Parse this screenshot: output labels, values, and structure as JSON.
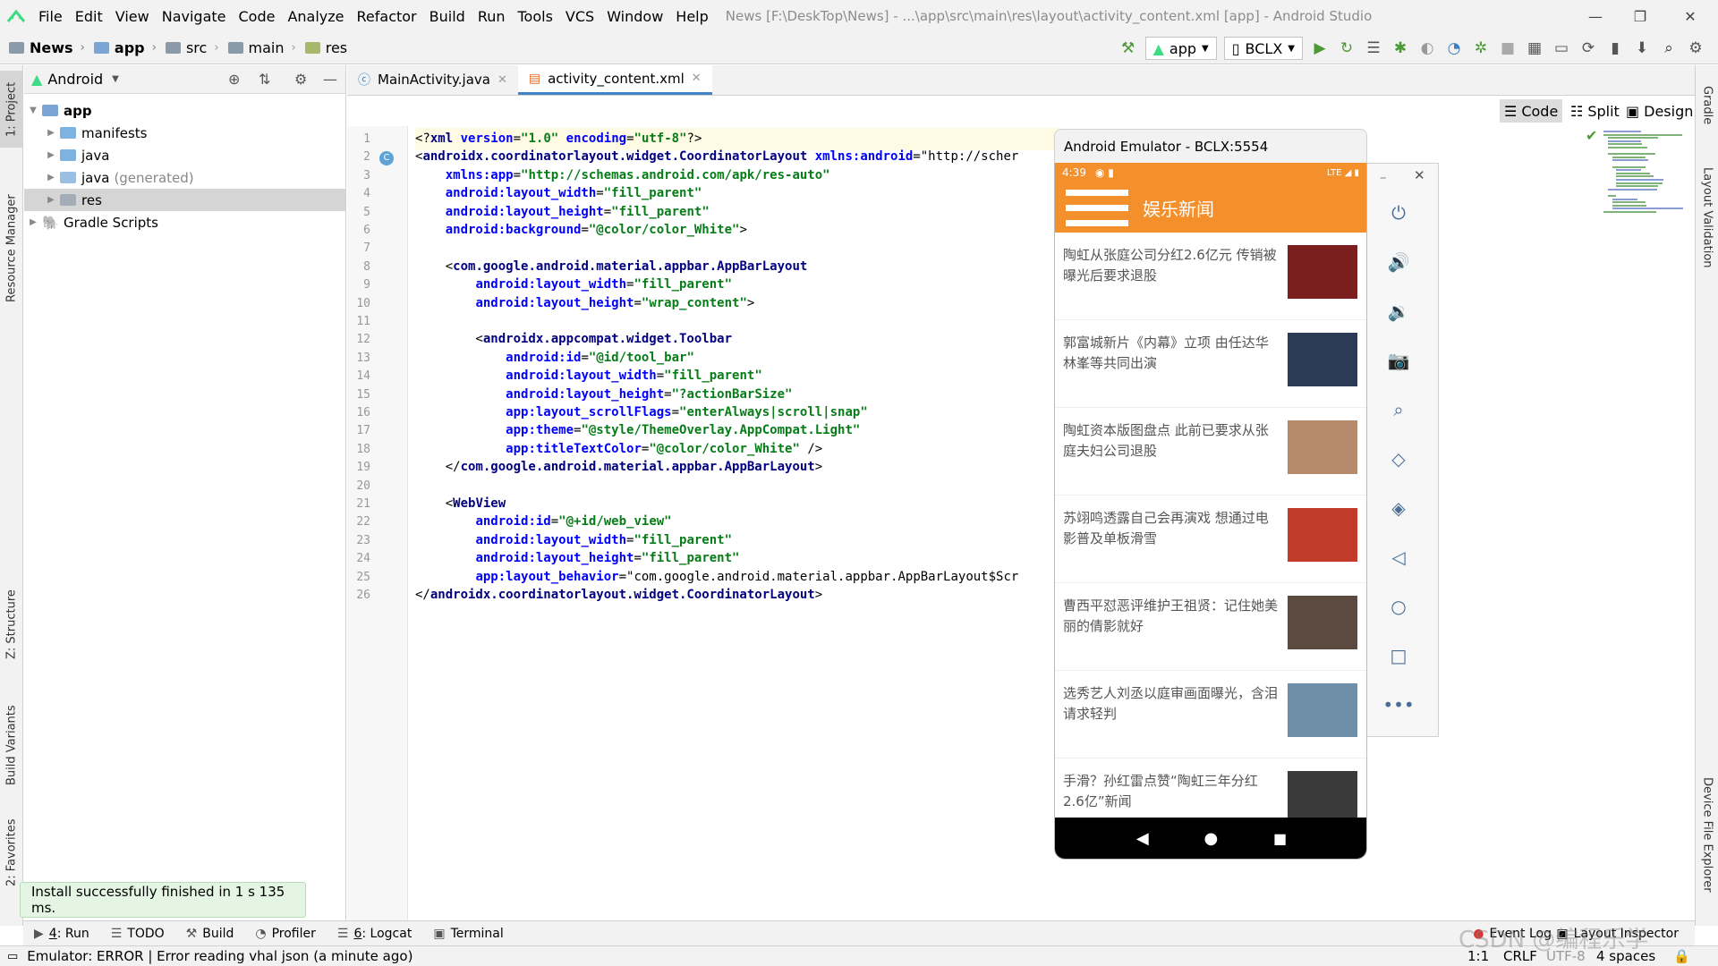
{
  "window": {
    "title": "News [F:\\DeskTop\\News] - ...\\app\\src\\main\\res\\layout\\activity_content.xml [app] - Android Studio"
  },
  "menu": [
    {
      "label": "File",
      "mn": "F"
    },
    {
      "label": "Edit",
      "mn": "E"
    },
    {
      "label": "View",
      "mn": "V"
    },
    {
      "label": "Navigate",
      "mn": "N"
    },
    {
      "label": "Code",
      "mn": "C"
    },
    {
      "label": "Analyze",
      "mn": "z"
    },
    {
      "label": "Refactor",
      "mn": "R"
    },
    {
      "label": "Build",
      "mn": "B"
    },
    {
      "label": "Run",
      "mn": "u"
    },
    {
      "label": "Tools",
      "mn": "T"
    },
    {
      "label": "VCS",
      "mn": "S"
    },
    {
      "label": "Window",
      "mn": "W"
    },
    {
      "label": "Help",
      "mn": "H"
    }
  ],
  "breadcrumb": [
    "News",
    "app",
    "src",
    "main",
    "res"
  ],
  "toolbar": {
    "run_config": "app",
    "device": "BCLX"
  },
  "project_panel": {
    "view_mode": "Android",
    "tree": [
      {
        "label": "app",
        "level": 0,
        "expanded": true,
        "bold": true
      },
      {
        "label": "manifests",
        "level": 1
      },
      {
        "label": "java",
        "level": 1
      },
      {
        "label": "java",
        "suffix": "(generated)",
        "level": 1
      },
      {
        "label": "res",
        "level": 1,
        "selected": true
      },
      {
        "label": "Gradle Scripts",
        "level": 0
      }
    ]
  },
  "left_stripe_tabs": [
    "1: Project",
    "Resource Manager",
    "Z: Structure",
    "Build Variants",
    "2: Favorites"
  ],
  "right_stripe_tabs": [
    "Gradle",
    "Layout Validation",
    "Device File Explorer"
  ],
  "editor": {
    "tabs": [
      {
        "label": "MainActivity.java",
        "active": false
      },
      {
        "label": "activity_content.xml",
        "active": true
      }
    ],
    "modes": [
      {
        "label": "Code",
        "active": true
      },
      {
        "label": "Split",
        "active": false
      },
      {
        "label": "Design",
        "active": false
      }
    ],
    "lines": [
      "<?xml version=\"1.0\" encoding=\"utf-8\"?>",
      "<androidx.coordinatorlayout.widget.CoordinatorLayout xmlns:android=\"http://scher",
      "    xmlns:app=\"http://schemas.android.com/apk/res-auto\"",
      "    android:layout_width=\"fill_parent\"",
      "    android:layout_height=\"fill_parent\"",
      "    android:background=\"@color/color_White\">",
      "",
      "    <com.google.android.material.appbar.AppBarLayout",
      "        android:layout_width=\"fill_parent\"",
      "        android:layout_height=\"wrap_content\">",
      "",
      "        <androidx.appcompat.widget.Toolbar",
      "            android:id=\"@id/tool_bar\"",
      "            android:layout_width=\"fill_parent\"",
      "            android:layout_height=\"?actionBarSize\"",
      "            app:layout_scrollFlags=\"enterAlways|scroll|snap\"",
      "            app:theme=\"@style/ThemeOverlay.AppCompat.Light\"",
      "            app:titleTextColor=\"@color/color_White\" />",
      "    </com.google.android.material.appbar.AppBarLayout>",
      "",
      "    <WebView",
      "        android:id=\"@+id/web_view\"",
      "        android:layout_width=\"fill_parent\"",
      "        android:layout_height=\"fill_parent\"",
      "        app:layout_behavior=\"com.google.android.material.appbar.AppBarLayout$Scr",
      "</androidx.coordinatorlayout.widget.CoordinatorLayout>"
    ]
  },
  "emulator": {
    "title": "Android Emulator - BCLX:5554",
    "status_time": "4:39",
    "status_network": "LTE",
    "app_title": "娱乐新闻",
    "news": [
      {
        "text": "陶虹从张庭公司分红2.6亿元 传销被曝光后要求退股",
        "thumb": "#7a1e1e"
      },
      {
        "text": "郭富城新片《内幕》立项 由任达华林峯等共同出演",
        "thumb": "#2b3b55"
      },
      {
        "text": "陶虹资本版图盘点 此前已要求从张庭夫妇公司退股",
        "thumb": "#b48a6a"
      },
      {
        "text": "苏翊鸣透露自己会再演戏 想通过电影普及单板滑雪",
        "thumb": "#c23b2b"
      },
      {
        "text": "曹西平怼恶评维护王祖贤：记住她美丽的倩影就好",
        "thumb": "#5a4a40"
      },
      {
        "text": "选秀艺人刘丞以庭审画面曝光，含泪请求轻判",
        "thumb": "#6f8fa8"
      },
      {
        "text": "手滑？孙红雷点赞“陶虹三年分红2.6亿”新闻",
        "thumb": "#3a3a3a"
      }
    ]
  },
  "bottom_tabs": [
    {
      "prefix": "4",
      "label": ": Run",
      "icon": "run-icon"
    },
    {
      "prefix": "",
      "label": "TODO",
      "icon": "todo-icon"
    },
    {
      "prefix": "",
      "label": "Build",
      "icon": "build-icon"
    },
    {
      "prefix": "",
      "label": "Profiler",
      "icon": "profiler-icon"
    },
    {
      "prefix": "6",
      "label": ": Logcat",
      "icon": "logcat-icon"
    },
    {
      "prefix": "",
      "label": "Terminal",
      "icon": "terminal-icon"
    }
  ],
  "bottom_right_tabs": [
    "Event Log",
    "Layout Inspector"
  ],
  "toast": "Install successfully finished in 1 s 135 ms.",
  "status": {
    "message": "Emulator: ERROR  | Error reading vhal json (a minute ago)",
    "position": "1:1",
    "line_sep": "CRLF",
    "encoding": "UTF-8",
    "indent": "4 spaces",
    "watermark": "CSDN @编程乐学"
  }
}
